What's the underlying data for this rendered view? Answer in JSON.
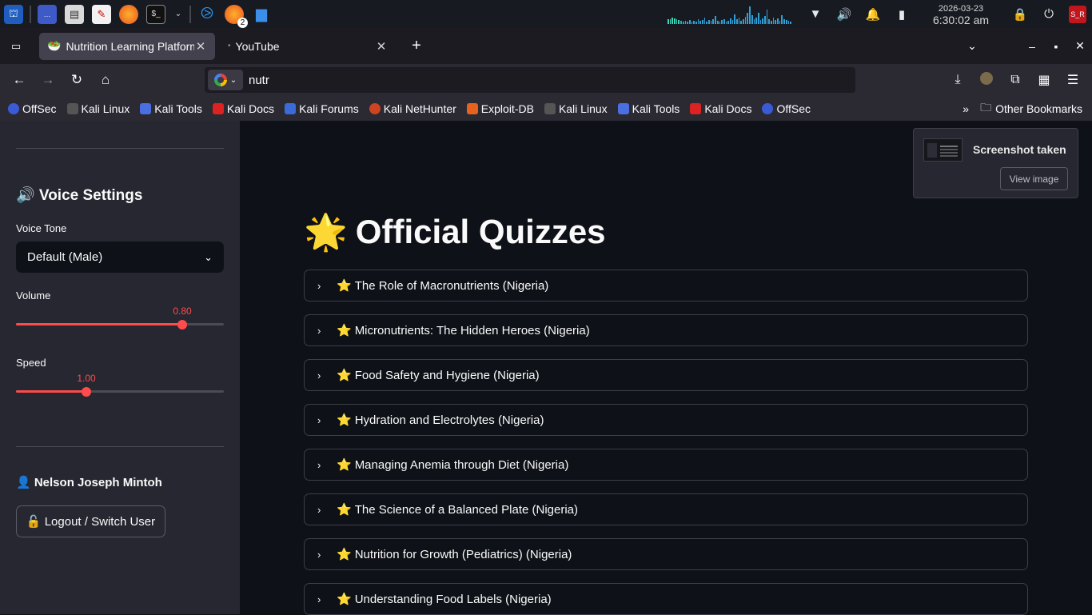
{
  "taskbar": {
    "apps": [
      "kali-menu",
      "workspace-switcher",
      "file-manager",
      "text-editor",
      "firefox",
      "terminal",
      "vscode",
      "firefox-active",
      "folder"
    ],
    "firefox_badge": "2",
    "clock": {
      "date": "2026-03-23",
      "time": "6:30:02 am"
    }
  },
  "browser": {
    "tabs": [
      {
        "title": "Nutrition Learning Platform",
        "active": true
      },
      {
        "title": "YouTube",
        "active": false
      }
    ],
    "url": "nutr",
    "bookmarks": [
      "OffSec",
      "Kali Linux",
      "Kali Tools",
      "Kali Docs",
      "Kali Forums",
      "Kali NetHunter",
      "Exploit-DB",
      "Kali Linux",
      "Kali Tools",
      "Kali Docs",
      "OffSec"
    ],
    "other_bookmarks": "Other Bookmarks"
  },
  "sidebar": {
    "voice_heading": "🔊 Voice Settings",
    "voice_tone_label": "Voice Tone",
    "voice_tone_value": "Default (Male)",
    "volume_label": "Volume",
    "volume_value": "0.80",
    "volume_fraction": 0.8,
    "speed_label": "Speed",
    "speed_value": "1.00",
    "speed_fraction": 0.34,
    "user_name": "👤 Nelson Joseph Mintoh",
    "logout_label": "🔓 Logout / Switch User"
  },
  "main": {
    "title_emoji": "🌟",
    "title": "Official Quizzes",
    "quizzes": [
      "The Role of Macronutrients (Nigeria)",
      "Micronutrients: The Hidden Heroes (Nigeria)",
      "Food Safety and Hygiene (Nigeria)",
      "Hydration and Electrolytes (Nigeria)",
      "Managing Anemia through Diet (Nigeria)",
      "The Science of a Balanced Plate (Nigeria)",
      "Nutrition for Growth (Pediatrics) (Nigeria)",
      "Understanding Food Labels (Nigeria)"
    ]
  },
  "toast": {
    "title": "Screenshot taken",
    "button": "View image"
  },
  "colors": {
    "accent": "#ff4b4b",
    "main_bg": "#0e1117",
    "sidebar_bg": "#262730"
  }
}
